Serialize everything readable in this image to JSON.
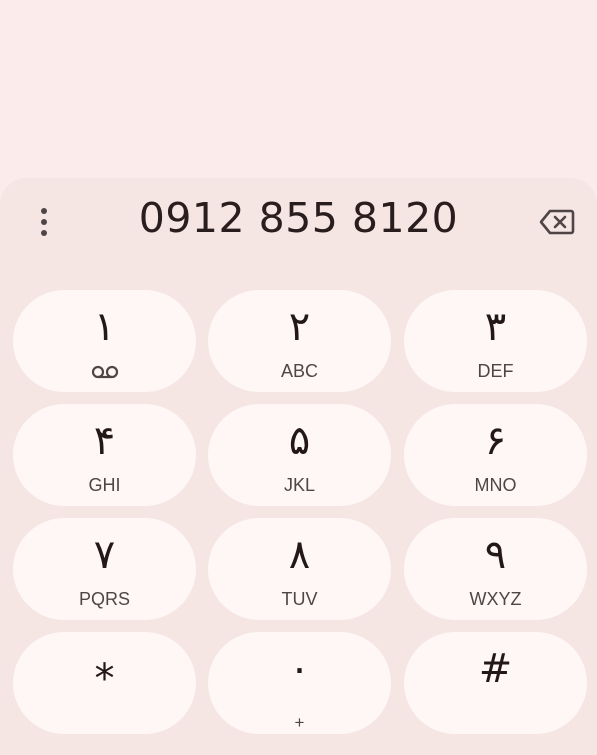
{
  "dialer": {
    "number": "0912 855 8120",
    "menu_icon": "more-vert-icon",
    "backspace_icon": "backspace-icon"
  },
  "keys": [
    {
      "digit": "۱",
      "letters": "",
      "icon": "voicemail-icon"
    },
    {
      "digit": "۲",
      "letters": "ABC"
    },
    {
      "digit": "۳",
      "letters": "DEF"
    },
    {
      "digit": "۴",
      "letters": "GHI"
    },
    {
      "digit": "۵",
      "letters": "JKL"
    },
    {
      "digit": "۶",
      "letters": "MNO"
    },
    {
      "digit": "۷",
      "letters": "PQRS"
    },
    {
      "digit": "۸",
      "letters": "TUV"
    },
    {
      "digit": "۹",
      "letters": "WXYZ"
    },
    {
      "digit": "*",
      "letters": ""
    },
    {
      "digit": "۰",
      "letters": "+"
    },
    {
      "digit": "#",
      "letters": ""
    }
  ],
  "colors": {
    "background": "#fbeceb",
    "panel": "#f5e5e3",
    "key": "#fff7f5",
    "text": "#231718",
    "secondary_text": "#4f4546"
  }
}
